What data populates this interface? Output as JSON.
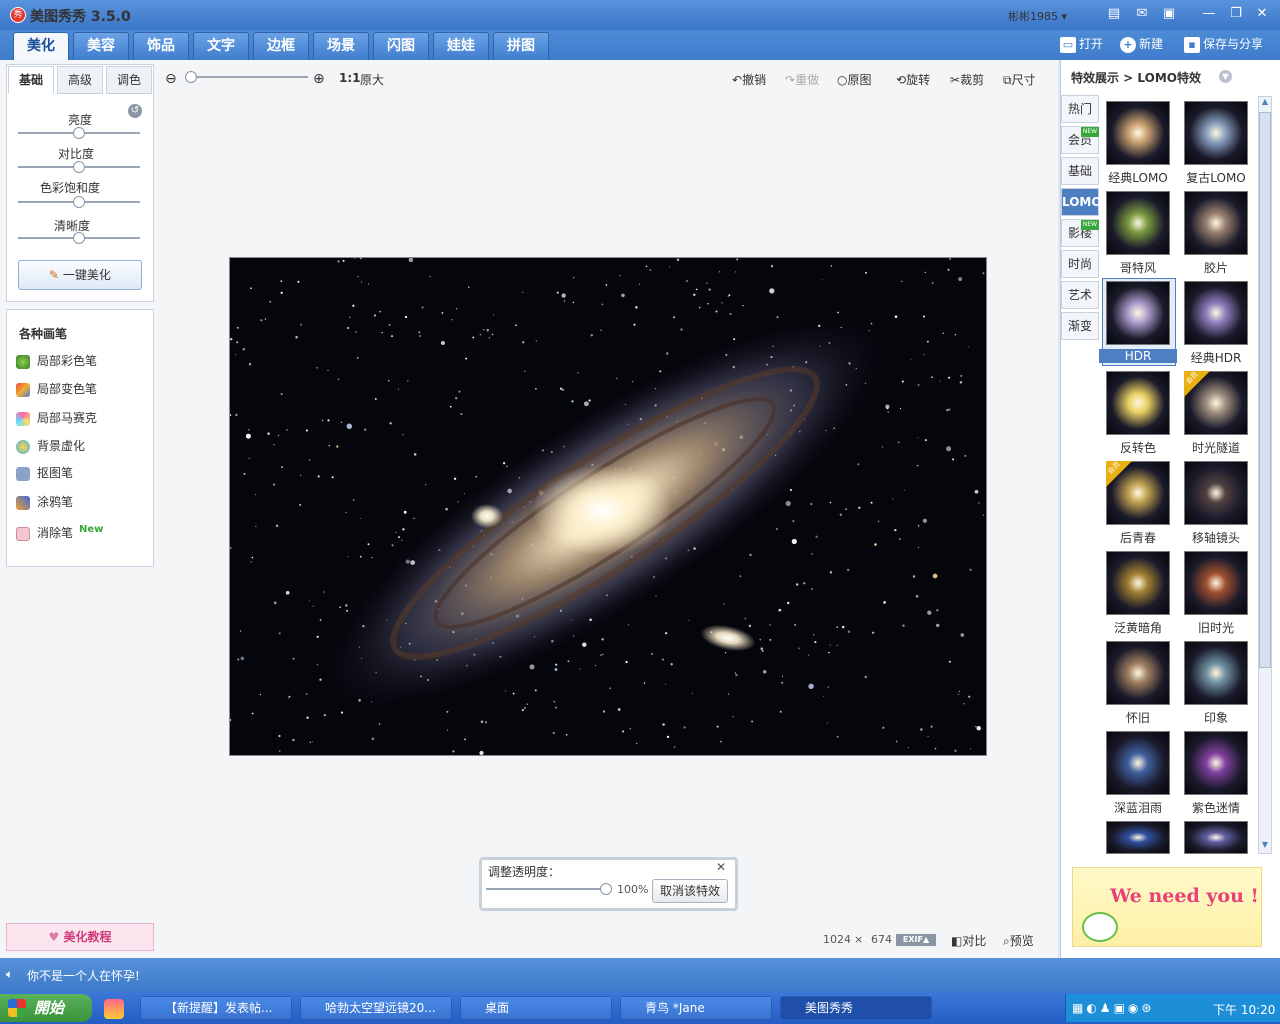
{
  "window": {
    "title": "美图秀秀 3.5.0",
    "user": "彬彬1985",
    "title_icons": [
      "doc-icon",
      "message-icon",
      "skin-icon",
      "minimize-icon",
      "restore-icon",
      "close-icon"
    ]
  },
  "main_tabs": [
    "美化",
    "美容",
    "饰品",
    "文字",
    "边框",
    "场景",
    "闪图",
    "娃娃",
    "拼图"
  ],
  "top_actions": {
    "open": "打开",
    "new": "新建",
    "save": "保存与分享"
  },
  "left": {
    "sub_tabs": [
      "基础",
      "高级",
      "调色"
    ],
    "sliders": [
      "亮度",
      "对比度",
      "色彩饱和度",
      "清晰度"
    ],
    "one_click": "一键美化",
    "brushes_title": "各种画笔",
    "brushes": [
      "局部彩色笔",
      "局部变色笔",
      "局部马赛克",
      "背景虚化",
      "抠图笔",
      "涂鸦笔",
      "消除笔"
    ],
    "new_badge": "New",
    "tutorial": "美化教程"
  },
  "toolbar": {
    "zoom_1to1": "1:1",
    "original_size": "原大",
    "undo": "撤销",
    "redo": "重做",
    "original": "原图",
    "rotate": "旋转",
    "crop": "裁剪",
    "size": "尺寸"
  },
  "dialog": {
    "title": "调整透明度：",
    "value": "100%",
    "value_fraction": 1.0,
    "cancel": "取消该特效"
  },
  "image_info": {
    "width": "1024",
    "times": "×",
    "height": "674",
    "exif": "EXIF▲",
    "compare": "对比",
    "preview": "预览"
  },
  "status": {
    "text": "你不是一个人在怀孕!"
  },
  "right": {
    "header": "特效展示 > LOMO特效",
    "categories": [
      "热门",
      "会员",
      "基础",
      "LOMO",
      "影楼",
      "时尚",
      "艺术",
      "渐变"
    ],
    "new_tag": "NEW",
    "thumbs": [
      "经典LOMO",
      "复古LOMO",
      "哥特风",
      "胶片",
      "HDR",
      "经典HDR",
      "反转色",
      "时光隧道",
      "后青春",
      "移轴镜头",
      "泛黄暗角",
      "旧时光",
      "怀旧",
      "印象",
      "深蓝泪雨",
      "紫色迷情"
    ],
    "vip_tag": "会员",
    "banner": "We need you !"
  },
  "taskbar": {
    "start": "開始",
    "tasks": [
      "【新提醒】发表帖...",
      "哈勃太空望远镜20...",
      "桌面",
      "青鸟 *Jane",
      "美图秀秀"
    ],
    "clock": "下午 10:20"
  },
  "colors": {
    "accent": "#3f7ccc",
    "vip": "#e8b010",
    "new": "#39a83a",
    "banner_text": "#e8407a"
  }
}
